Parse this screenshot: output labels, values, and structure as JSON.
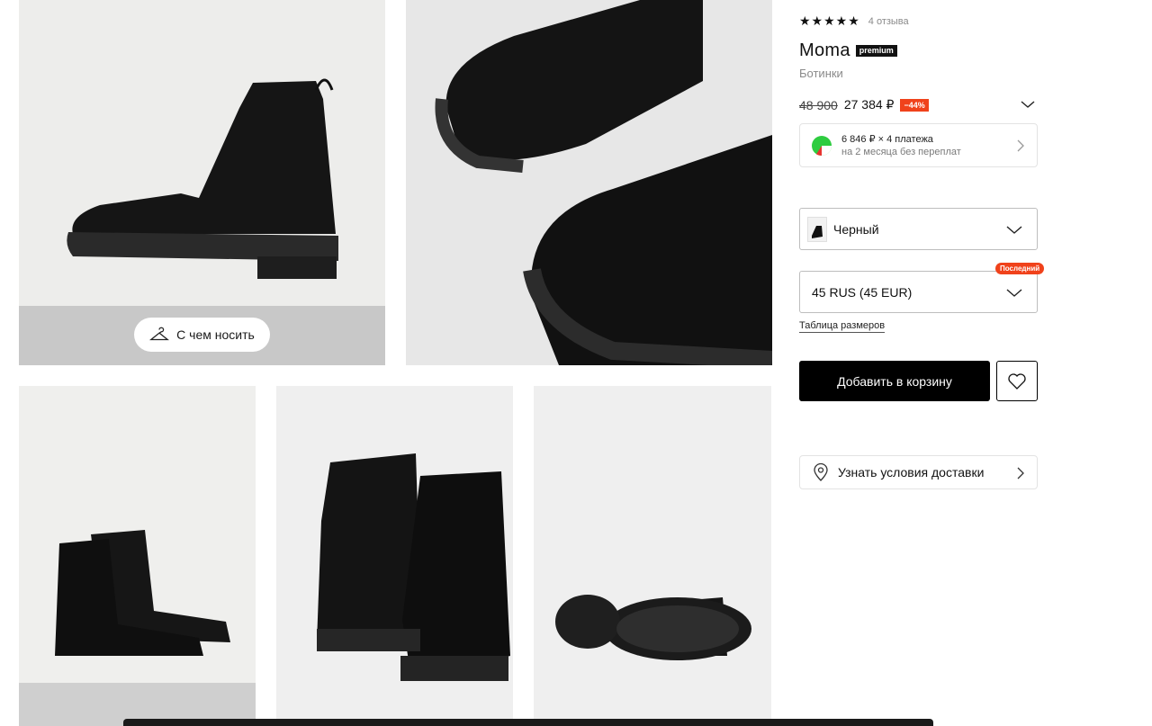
{
  "gallery": {
    "images": [
      {
        "name": "boot-side-view"
      },
      {
        "name": "boot-closeup"
      },
      {
        "name": "boots-pair-front"
      },
      {
        "name": "boots-pair-back"
      },
      {
        "name": "boot-sole"
      }
    ],
    "wear_label": "С чем носить"
  },
  "product": {
    "stars": "★★★★★",
    "reviews": "4 отзыва",
    "brand": "Moma",
    "premium_label": "premium",
    "category": "Ботинки",
    "old_price": "48 900",
    "new_price": "27 384 ₽",
    "discount": "−44%"
  },
  "installment": {
    "main": "6 846 ₽ × 4 платежа",
    "sub": "на 2 месяца без переплат"
  },
  "color_select": {
    "value": "Черный"
  },
  "size_select": {
    "value": "45 RUS (45 EUR)",
    "badge": "Последний"
  },
  "size_table_link": "Таблица размеров",
  "actions": {
    "add_to_cart": "Добавить в корзину"
  },
  "delivery": {
    "label": "Узнать условия доставки"
  },
  "colors": {
    "accent": "#f0421b",
    "primary": "#000000",
    "muted": "#8a8a8a"
  }
}
